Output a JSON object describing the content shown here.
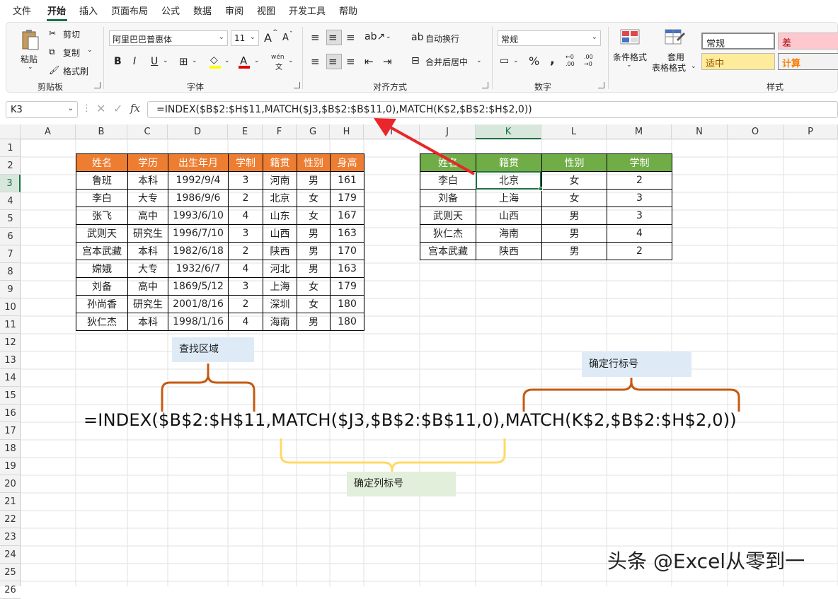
{
  "menu": {
    "items": [
      "文件",
      "开始",
      "插入",
      "页面布局",
      "公式",
      "数据",
      "审阅",
      "视图",
      "开发工具",
      "帮助"
    ],
    "active": "开始"
  },
  "ribbon": {
    "clipboard": {
      "paste": "粘贴",
      "cut": "剪切",
      "copy": "复制",
      "format_painter": "格式刷",
      "label": "剪贴板"
    },
    "font": {
      "name": "阿里巴巴普惠体",
      "size": "11",
      "grow": "A",
      "shrink": "A",
      "bold": "B",
      "italic": "I",
      "underline": "U",
      "font_color": "A",
      "phonetic": "wén",
      "label": "字体"
    },
    "alignment": {
      "wrap": "自动换行",
      "merge": "合并后居中",
      "label": "对齐方式"
    },
    "number": {
      "format": "常规",
      "percent": "%",
      "comma": ",",
      "inc_decimal": "←0 .00",
      "dec_decimal": ".00 →0",
      "label": "数字"
    },
    "styles": {
      "conditional": "条件格式",
      "table_format_1": "套用",
      "table_format_2": "表格格式",
      "normal": "常规",
      "bad": "差",
      "neutral": "适中",
      "calc": "计算",
      "label": "样式"
    }
  },
  "formula_bar": {
    "name_box": "K3",
    "fx": "fx",
    "formula": "=INDEX($B$2:$H$11,MATCH($J3,$B$2:$B$11,0),MATCH(K$2,$B$2:$H$2,0))"
  },
  "columns": [
    "A",
    "B",
    "C",
    "D",
    "E",
    "F",
    "G",
    "H",
    "I",
    "J",
    "K",
    "L",
    "M",
    "N",
    "O",
    "P"
  ],
  "rows": [
    "1",
    "2",
    "3",
    "4",
    "5",
    "6",
    "7",
    "8",
    "9",
    "10",
    "11",
    "12",
    "13",
    "14",
    "15",
    "16",
    "17",
    "18",
    "19",
    "20",
    "21",
    "22",
    "23",
    "24",
    "25",
    "26"
  ],
  "selected_column": "K",
  "selected_row": "3",
  "left_table": {
    "headers": [
      "姓名",
      "学历",
      "出生年月",
      "学制",
      "籍贯",
      "性别",
      "身高"
    ],
    "rows": [
      [
        "鲁班",
        "本科",
        "1992/9/4",
        "3",
        "河南",
        "男",
        "161"
      ],
      [
        "李白",
        "大专",
        "1986/9/6",
        "2",
        "北京",
        "女",
        "179"
      ],
      [
        "张飞",
        "高中",
        "1993/6/10",
        "4",
        "山东",
        "女",
        "167"
      ],
      [
        "武则天",
        "研究生",
        "1996/7/10",
        "3",
        "山西",
        "男",
        "163"
      ],
      [
        "宫本武藏",
        "本科",
        "1982/6/18",
        "2",
        "陕西",
        "男",
        "170"
      ],
      [
        "嫦娥",
        "大专",
        "1932/6/7",
        "4",
        "河北",
        "男",
        "163"
      ],
      [
        "刘备",
        "高中",
        "1869/5/12",
        "3",
        "上海",
        "女",
        "179"
      ],
      [
        "孙尚香",
        "研究生",
        "2001/8/16",
        "2",
        "深圳",
        "女",
        "180"
      ],
      [
        "狄仁杰",
        "本科",
        "1998/1/16",
        "4",
        "海南",
        "男",
        "180"
      ]
    ],
    "header_color": "#ed7d31"
  },
  "right_table": {
    "headers": [
      "姓名",
      "籍贯",
      "性别",
      "学制"
    ],
    "rows": [
      [
        "李白",
        "北京",
        "女",
        "2"
      ],
      [
        "刘备",
        "上海",
        "女",
        "3"
      ],
      [
        "武则天",
        "山西",
        "男",
        "3"
      ],
      [
        "狄仁杰",
        "海南",
        "男",
        "4"
      ],
      [
        "宫本武藏",
        "陕西",
        "男",
        "2"
      ]
    ],
    "header_color": "#70ad47"
  },
  "annotations": {
    "lookup_range": "查找区域",
    "row_number": "确定行标号",
    "col_number": "确定列标号",
    "big_formula": "=INDEX($B$2:$H$11,MATCH($J3,$B$2:$B$11,0),MATCH(K$2,$B$2:$H$2,0))",
    "lookup_color": "#c55a11",
    "col_brace_color": "#ffd966",
    "arrow_color": "#e8262b"
  },
  "watermark": "头条 @Excel从零到一"
}
